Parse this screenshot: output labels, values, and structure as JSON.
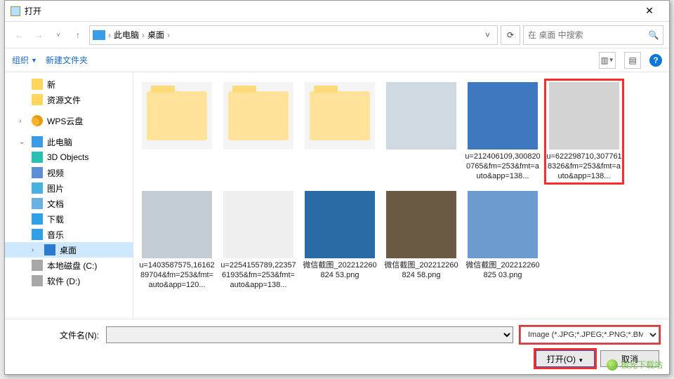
{
  "title": "打开",
  "nav": {
    "path_parts": [
      "此电脑",
      "桌面"
    ],
    "search_placeholder": "在 桌面 中搜索"
  },
  "toolbar": {
    "organize": "组织",
    "new_folder": "新建文件夹"
  },
  "sidebar": {
    "quick": [
      {
        "label": "新",
        "icon": "ico-folder"
      },
      {
        "label": "资源文件",
        "icon": "ico-folder"
      }
    ],
    "cloud": {
      "label": "WPS云盘"
    },
    "pc": {
      "label": "此电脑"
    },
    "pc_children": [
      {
        "label": "3D Objects",
        "icon": "ico-3d"
      },
      {
        "label": "视频",
        "icon": "ico-video"
      },
      {
        "label": "图片",
        "icon": "ico-pic"
      },
      {
        "label": "文档",
        "icon": "ico-doc"
      },
      {
        "label": "下载",
        "icon": "ico-dl"
      },
      {
        "label": "音乐",
        "icon": "ico-music"
      },
      {
        "label": "桌面",
        "icon": "ico-desk",
        "selected": true
      },
      {
        "label": "本地磁盘 (C:)",
        "icon": "ico-drive"
      },
      {
        "label": "软件 (D:)",
        "icon": "ico-drive"
      }
    ]
  },
  "files": {
    "row1": [
      {
        "type": "folder",
        "cap": ""
      },
      {
        "type": "folder",
        "cap": ""
      },
      {
        "type": "folder",
        "cap": ""
      },
      {
        "type": "image",
        "cap": "",
        "bg": "#cfd9e2"
      },
      {
        "type": "image",
        "cap": "u=212406109,3008200765&fm=253&fmt=auto&app=138...",
        "bg": "#3d78c0"
      },
      {
        "type": "image",
        "cap": "u=622298710,3077618326&fm=253&fmt=auto&app=138...",
        "bg": "#d3d3d3",
        "highlight": true
      },
      {
        "type": "image",
        "cap": "u=1403587575,1616289704&fm=253&fmt=auto&app=120...",
        "bg": "#c4ccd4"
      }
    ],
    "row2": [
      {
        "type": "image",
        "cap": "u=2254155789,2235761935&fm=253&fmt=auto&app=138...",
        "bg": "#efefef"
      },
      {
        "type": "image",
        "cap": "微信截图_202212260824 53.png",
        "bg": "#2a6aa5"
      },
      {
        "type": "image",
        "cap": "微信截图_202212260824 58.png",
        "bg": "#6b5a43"
      },
      {
        "type": "image",
        "cap": "微信截图_202212260825 03.png",
        "bg": "#6b9bd0"
      }
    ]
  },
  "bottom": {
    "file_label": "文件名(N):",
    "filter_value": "Image (*.JPG;*.JPEG;*.PNG;*.BMP)",
    "open": "打开(O)",
    "cancel": "取消"
  },
  "watermark": "极光下载站"
}
